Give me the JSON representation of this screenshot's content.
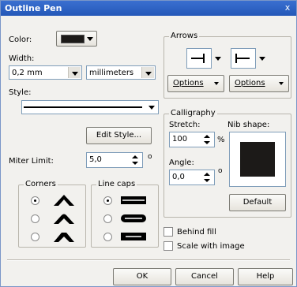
{
  "title": "Outline Pen",
  "close_glyph": "x",
  "color": {
    "label": "Color:",
    "swatch": "#1c1a18"
  },
  "width": {
    "label": "Width:",
    "value": "0,2 mm",
    "unit": "millimeters"
  },
  "style": {
    "label": "Style:"
  },
  "edit_style_label": "Edit Style...",
  "miter": {
    "label": "Miter Limit:",
    "value": "5,0",
    "unit_mark": "o"
  },
  "corners": {
    "label": "Corners",
    "selected_index": 0,
    "options": [
      "miter-corner-icon",
      "round-corner-icon",
      "bevel-corner-icon"
    ]
  },
  "line_caps": {
    "label": "Line caps",
    "selected_index": 0,
    "options": [
      "butt-cap-icon",
      "round-cap-icon",
      "square-cap-icon"
    ]
  },
  "arrows": {
    "label": "Arrows",
    "options_left": "Options",
    "options_right": "Options"
  },
  "calligraphy": {
    "label": "Calligraphy",
    "stretch_label": "Stretch:",
    "stretch_value": "100",
    "percent": "%",
    "nib_label": "Nib shape:",
    "angle_label": "Angle:",
    "angle_value": "0,0",
    "angle_unit": "o",
    "default_label": "Default"
  },
  "behind_fill": {
    "label": "Behind fill",
    "checked": false
  },
  "scale_with_image": {
    "label": "Scale with image",
    "checked": false
  },
  "footer": {
    "ok": "OK",
    "cancel": "Cancel",
    "help": "Help"
  }
}
